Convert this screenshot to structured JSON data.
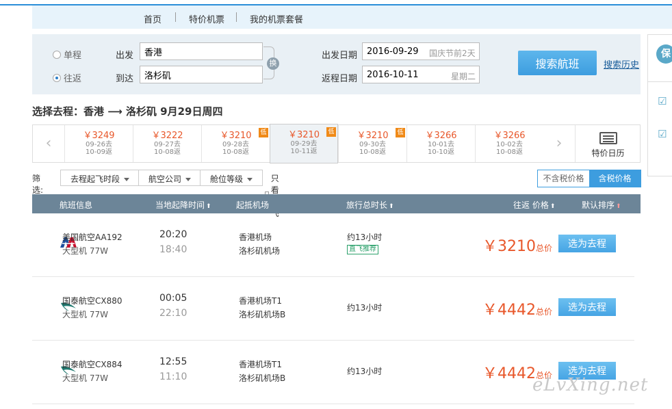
{
  "nav": {
    "items": [
      "首页",
      "特价机票",
      "我的机票套餐"
    ]
  },
  "search": {
    "trip_types": [
      {
        "label": "单程",
        "selected": false
      },
      {
        "label": "往返",
        "selected": true
      }
    ],
    "from_label": "出发",
    "from_value": "香港",
    "to_label": "到达",
    "to_value": "洛杉矶",
    "swap_label": "换",
    "depart_label": "出发日期",
    "depart_value": "2016-09-29",
    "depart_hint": "国庆节前2天",
    "return_label": "返程日期",
    "return_value": "2016-10-11",
    "return_hint": "星期二",
    "search_button": "搜索航班",
    "history_link": "搜索历史"
  },
  "side": {
    "badge": "保"
  },
  "route_title": "选择去程：香港 ⟶ 洛杉矶  9月29日周四",
  "date_strip": {
    "prev_arrow": "‹",
    "next_arrow": "›",
    "low_badge": "低",
    "days": [
      {
        "price": "￥3249",
        "go": "09-26去",
        "back": "10-09返",
        "low": false,
        "active": false
      },
      {
        "price": "￥3222",
        "go": "09-27去",
        "back": "10-08返",
        "low": false,
        "active": false
      },
      {
        "price": "￥3210",
        "go": "09-28去",
        "back": "10-08返",
        "low": true,
        "active": false
      },
      {
        "price": "￥3210",
        "go": "09-29去",
        "back": "10-11返",
        "low": true,
        "active": true
      },
      {
        "price": "￥3210",
        "go": "09-30去",
        "back": "10-08返",
        "low": true,
        "active": false
      },
      {
        "price": "￥3266",
        "go": "10-01去",
        "back": "10-10返",
        "low": false,
        "active": false
      },
      {
        "price": "￥3266",
        "go": "10-02去",
        "back": "10-08返",
        "low": false,
        "active": false
      }
    ],
    "calendar_label": "特价日历"
  },
  "filters": {
    "label": "筛选:",
    "dropdowns": [
      "去程起飞时段",
      "航空公司",
      "舱位等级"
    ],
    "direct_only": "只看直飞",
    "tax_options": [
      {
        "label": "不含税价格",
        "selected": false
      },
      {
        "label": "含税价格",
        "selected": true
      }
    ]
  },
  "table": {
    "headers": {
      "flight": "航班信息",
      "time": "当地起降时间",
      "airport": "起抵机场",
      "duration": "旅行总时长",
      "price": "往返 价格",
      "sort": "默认排序"
    },
    "sort_arrow": "⬆",
    "rows": [
      {
        "airline": "美国航空AA192",
        "plane": "大型机 77W",
        "logo": "american-airlines-logo",
        "dep_time": "20:20",
        "arr_time": "18:40",
        "dep_airport": "香港机场",
        "arr_airport": "洛杉矶机场",
        "duration": "约13小时",
        "tag": "直飞推荐",
        "price": "￥3210",
        "price_unit": "总价",
        "button": "选为去程"
      },
      {
        "airline": "国泰航空CX880",
        "plane": "大型机 77W",
        "logo": "cathay-pacific-logo",
        "dep_time": "00:05",
        "arr_time": "22:10",
        "dep_airport": "香港机场T1",
        "arr_airport": "洛杉矶机场B",
        "duration": "约13小时",
        "tag": "",
        "price": "￥4442",
        "price_unit": "总价",
        "button": "选为去程"
      },
      {
        "airline": "国泰航空CX884",
        "plane": "大型机 77W",
        "logo": "cathay-pacific-logo",
        "dep_time": "12:55",
        "arr_time": "11:10",
        "dep_airport": "香港机场T1",
        "arr_airport": "洛杉矶机场B",
        "duration": "约13小时",
        "tag": "",
        "price": "￥4442",
        "price_unit": "总价",
        "button": "选为去程"
      }
    ]
  },
  "watermark": "eLvXing.net",
  "colors": {
    "accent": "#3d9ddf",
    "price": "#e8572a",
    "header": "#6c8598"
  }
}
